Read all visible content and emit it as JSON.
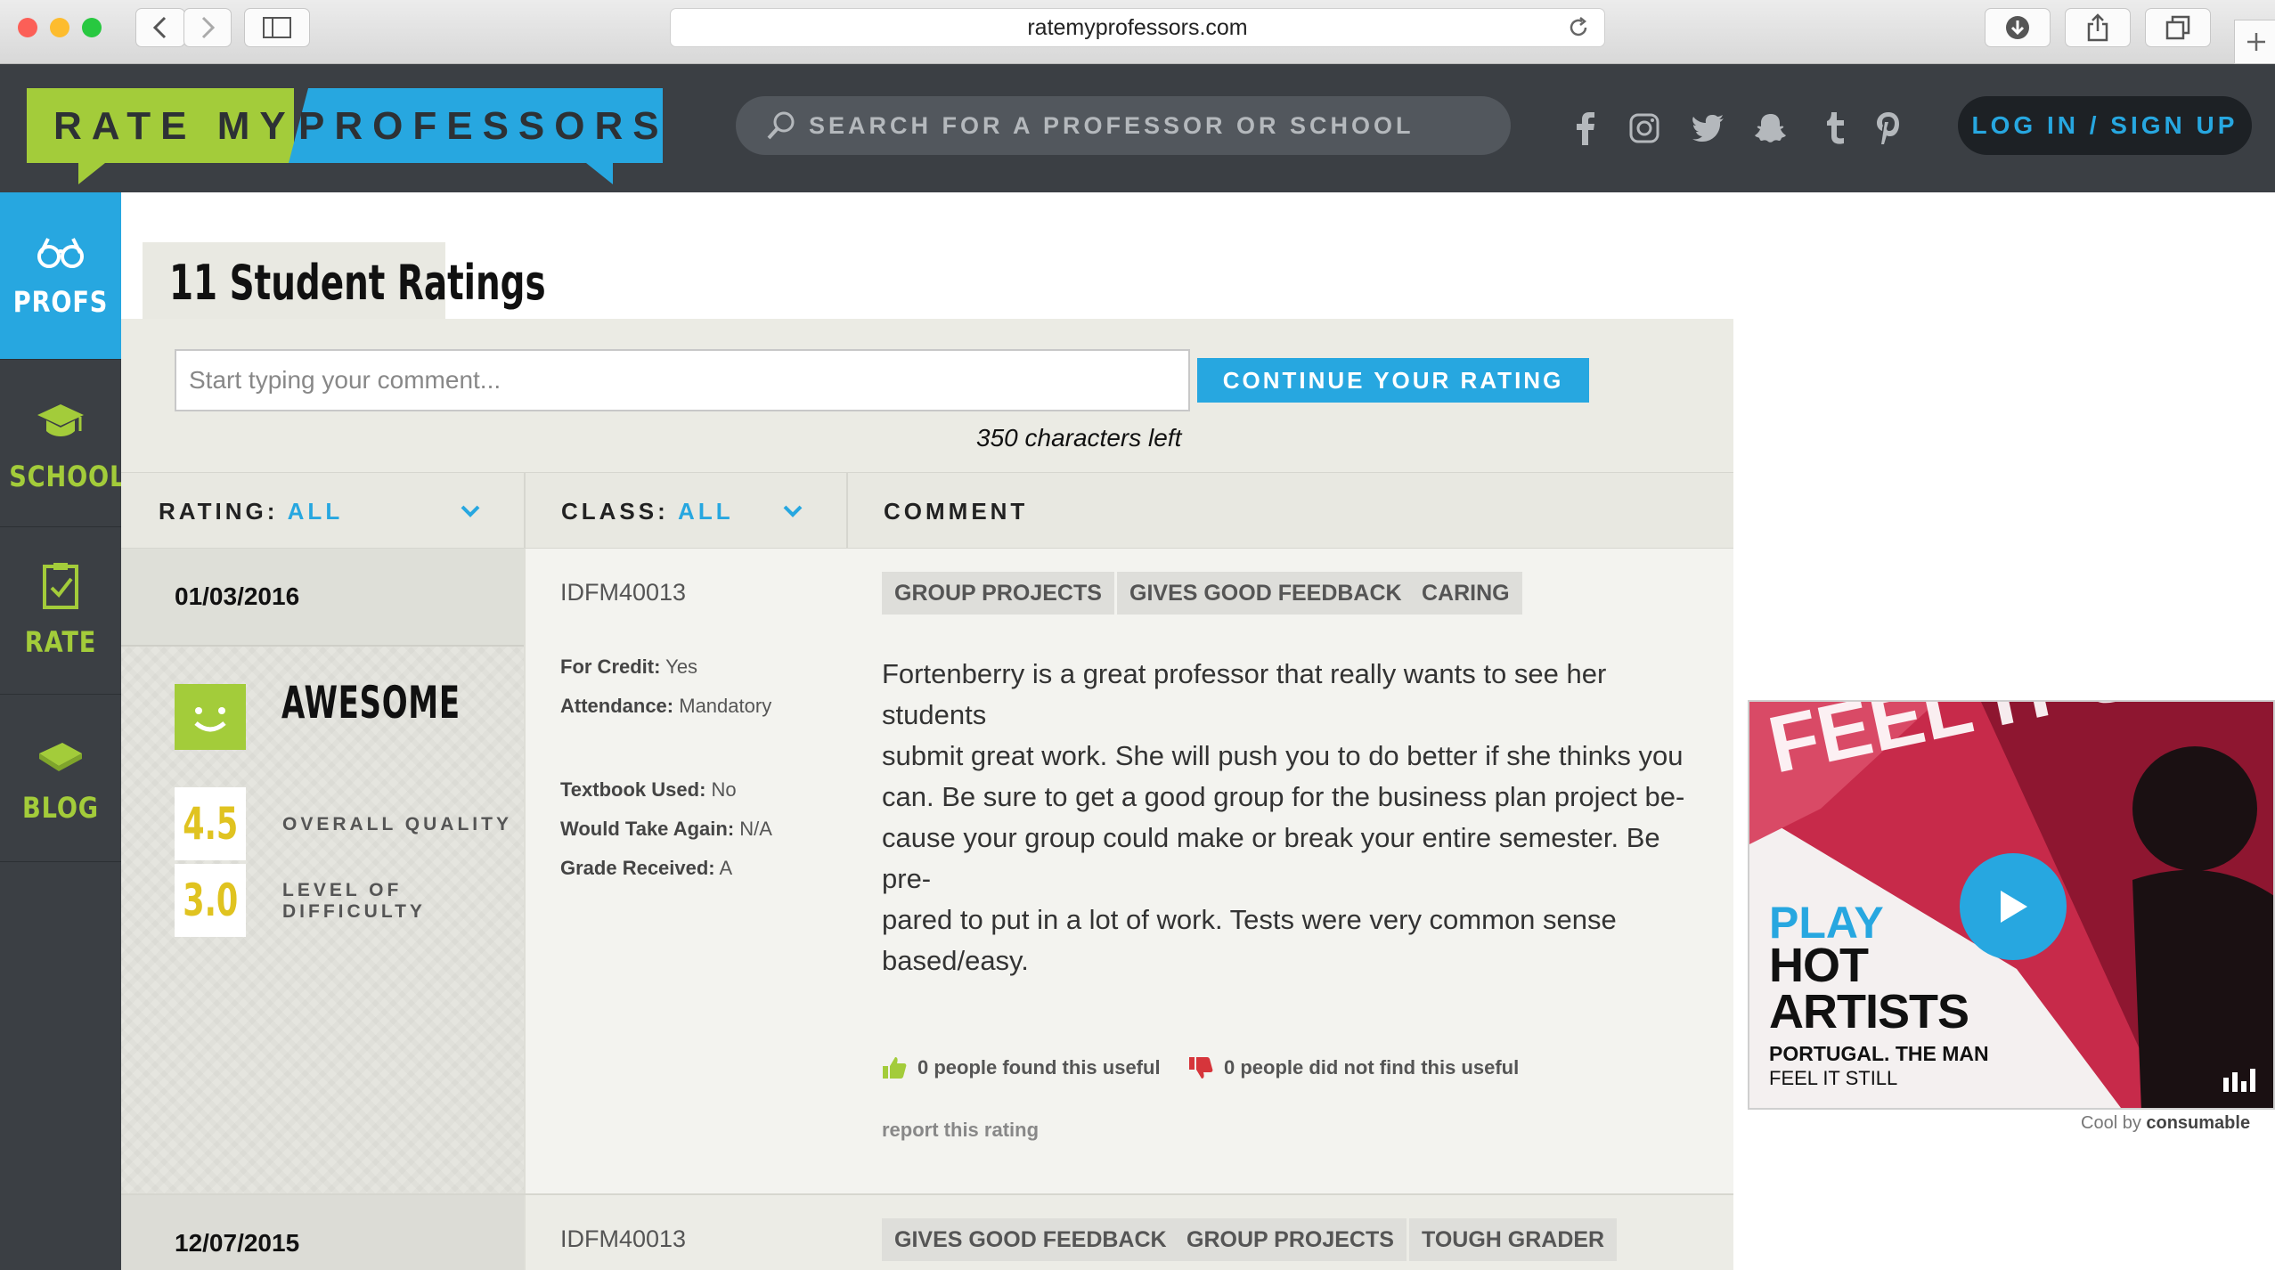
{
  "browser": {
    "url": "ratemyprofessors.com"
  },
  "header": {
    "logo_part1": "RATE MY",
    "logo_part2": "PROFESSORS",
    "search_placeholder": "SEARCH FOR A PROFESSOR OR SCHOOL",
    "social_icons": [
      "facebook-icon",
      "instagram-icon",
      "twitter-icon",
      "snapchat-icon",
      "tumblr-icon",
      "pinterest-icon"
    ],
    "login_label": "LOG IN / SIGN UP"
  },
  "sidenav": {
    "items": [
      {
        "label": "PROFS",
        "icon": "glasses-icon",
        "active": true
      },
      {
        "label": "SCHOOL",
        "icon": "graduation-cap-icon",
        "active": false
      },
      {
        "label": "RATE",
        "icon": "clipboard-check-icon",
        "active": false
      },
      {
        "label": "BLOG",
        "icon": "book-icon",
        "active": false
      }
    ]
  },
  "main": {
    "title": "11 Student Ratings",
    "comment_placeholder": "Start typing your comment...",
    "continue_label": "CONTINUE YOUR RATING",
    "chars_left": "350 characters left",
    "columns": {
      "rating_label": "RATING:",
      "rating_value": "ALL",
      "class_label": "CLASS:",
      "class_value": "ALL",
      "comment_label": "COMMENT"
    },
    "ratings": [
      {
        "date": "01/03/2016",
        "mood": "AWESOME",
        "overall_quality": "4.5",
        "overall_quality_label": "OVERALL QUALITY",
        "difficulty": "3.0",
        "difficulty_label_1": "LEVEL OF",
        "difficulty_label_2": "DIFFICULTY",
        "class_code": "IDFM40013",
        "meta": [
          {
            "key": "For Credit:",
            "value": "Yes"
          },
          {
            "key": "Attendance:",
            "value": "Mandatory"
          },
          {
            "key": "Textbook Used:",
            "value": "No"
          },
          {
            "key": "Would Take Again:",
            "value": "N/A"
          },
          {
            "key": "Grade Received:",
            "value": "A"
          }
        ],
        "tags": [
          "GROUP PROJECTS",
          "GIVES GOOD FEEDBACK",
          "CARING"
        ],
        "comment_lines": [
          "Fortenberry is a great professor that really wants to see her students",
          "submit great work. She will push you to do better if she thinks you",
          "can. Be sure to get a good group for the business plan project be-",
          "cause your group could make or break your entire semester. Be pre-",
          "pared to put in a lot of work. Tests were very common sense",
          "based/easy."
        ],
        "useful": "0 people found this useful",
        "not_useful": "0 people did not find this useful",
        "report": "report this rating"
      },
      {
        "date": "12/07/2015",
        "class_code": "IDFM40013",
        "tags": [
          "GIVES GOOD FEEDBACK",
          "GROUP PROJECTS",
          "TOUGH GRADER"
        ]
      }
    ]
  },
  "ad": {
    "play": "PLAY",
    "hot_line1": "HOT",
    "hot_line2": "ARTISTS",
    "band": "PORTUGAL. THE MAN",
    "song": "FEEL IT STILL",
    "art_text": "FEEL IT STILL",
    "cool_by": "Cool by",
    "brand": "consumable"
  },
  "colors": {
    "accent_blue": "#27a7e0",
    "accent_green": "#a3cc3a",
    "score_yellow": "#e0c320",
    "header_dark": "#3b3f44"
  }
}
